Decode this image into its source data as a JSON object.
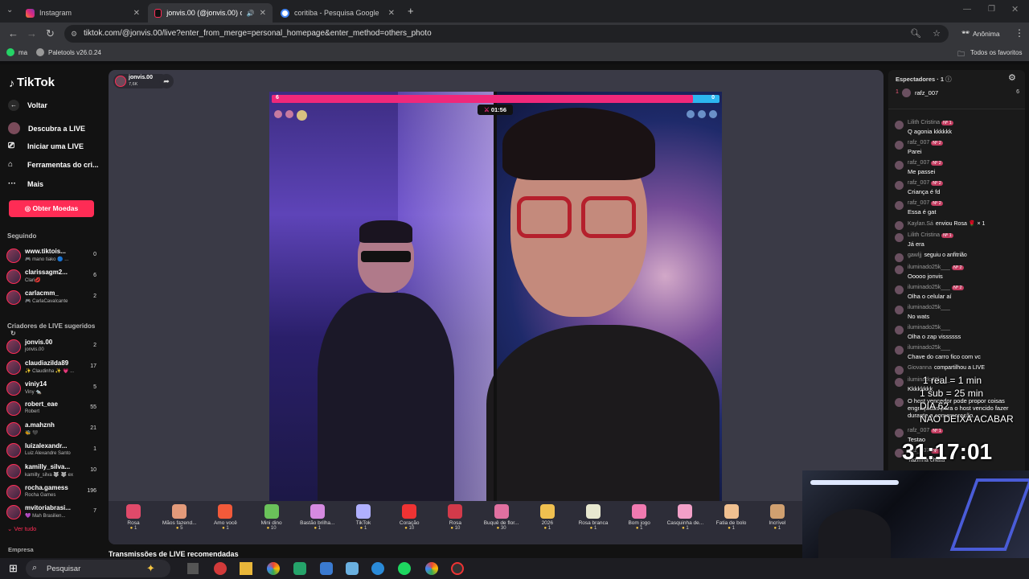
{
  "browser": {
    "tabs": [
      {
        "label": "Instagram",
        "color": "#e1306c"
      },
      {
        "label": "jonvis.00 (@jonvis.00) com...",
        "color": "#111111"
      },
      {
        "label": "coritiba - Pesquisa Google",
        "color": "#4285f4"
      }
    ],
    "url": "tiktok.com/@jonvis.00/live?enter_from_merge=personal_homepage&enter_method=others_photo",
    "profile_label": "Anônima",
    "bookmarks": [
      "ma",
      "Paletools v26.0.24"
    ],
    "favorites_label": "Todos os favoritos"
  },
  "sidebar": {
    "logo": "TikTok",
    "back_label": "Voltar",
    "nav": [
      {
        "label": "Descubra a LIVE",
        "icon": "live-avatar-icon"
      },
      {
        "label": "Iniciar uma LIVE",
        "icon": "camera-icon"
      },
      {
        "label": "Ferramentas do cri...",
        "icon": "home-icon"
      },
      {
        "label": "Mais",
        "icon": "more-icon"
      }
    ],
    "coins_button": "Obter Moedas",
    "following_title": "Seguindo",
    "following": [
      {
        "name": "www.tiktois...",
        "sub": "🎮 mano tiako 🔵 ...",
        "count": "0"
      },
      {
        "name": "clarissagm2...",
        "sub": "Clari💋",
        "count": "6"
      },
      {
        "name": "carlacmm_",
        "sub": "🎮 CarlaCavalcante",
        "count": "2"
      }
    ],
    "creators_title": "Criadores de LIVE sugeridos",
    "creators": [
      {
        "name": "jonvis.00",
        "sub": "jonvis.00",
        "count": "2"
      },
      {
        "name": "claudiazilda89",
        "sub": "✨ Claudinha ✨ 💗 ...",
        "count": "17"
      },
      {
        "name": "viniy14",
        "sub": "Viny 🐀",
        "count": "5"
      },
      {
        "name": "robert_eae",
        "sub": "Robert",
        "count": "55"
      },
      {
        "name": "a.mahznh",
        "sub": "🐝 🖤",
        "count": "21"
      },
      {
        "name": "luizalexandr...",
        "sub": "Luiz Alexandre Santo",
        "count": "1"
      },
      {
        "name": "kamilly_silva...",
        "sub": "kamilly_silva 🐺 🐺 ex",
        "count": "10"
      },
      {
        "name": "rocha.gamess",
        "sub": "Rocha Games",
        "count": "196"
      },
      {
        "name": "mvitoriabrasi...",
        "sub": "💜 Mah Brasilien...",
        "count": "7"
      }
    ],
    "see_all": "Ver tudo",
    "company": "Empresa"
  },
  "live": {
    "host": "jonvis.00",
    "likes": "7,6K",
    "score_left": "6",
    "score_right": "0",
    "timer": "01:56",
    "recommended_title": "Transmissões de LIVE recomendadas"
  },
  "gifts": [
    {
      "name": "Rosa",
      "price": "1",
      "color": "#e04a6a"
    },
    {
      "name": "Mãos fazend...",
      "price": "5",
      "color": "#e39a7a"
    },
    {
      "name": "Amo você",
      "price": "1",
      "color": "#f25a3a"
    },
    {
      "name": "Mini dino",
      "price": "10",
      "color": "#6ac25a"
    },
    {
      "name": "Bastão brilha...",
      "price": "1",
      "color": "#d58ae0"
    },
    {
      "name": "TikTok",
      "price": "1",
      "color": "#b0b0ff"
    },
    {
      "name": "Coração",
      "price": "10",
      "color": "#e33"
    },
    {
      "name": "Rosa",
      "price": "10",
      "color": "#d33a4a"
    },
    {
      "name": "Buquê de flor...",
      "price": "30",
      "color": "#e070a0"
    },
    {
      "name": "2026",
      "price": "1",
      "color": "#f0c050"
    },
    {
      "name": "Rosa branca",
      "price": "1",
      "color": "#e8e8d0"
    },
    {
      "name": "Bom jogo",
      "price": "1",
      "color": "#f07ab0"
    },
    {
      "name": "Casquinha de...",
      "price": "1",
      "color": "#f2a0c8"
    },
    {
      "name": "Fatia de bolo",
      "price": "1",
      "color": "#f0c090"
    },
    {
      "name": "Incrível",
      "price": "1",
      "color": "#d0a070"
    }
  ],
  "chat": {
    "viewers_title": "Espectadores",
    "viewers_count": "1",
    "top_viewer": {
      "rank": "1",
      "name": "rafz_007",
      "score": "6"
    },
    "messages": [
      {
        "user": "Lilith Cristina",
        "badge": "Nº 1",
        "text": "Q agonia kkkkkk"
      },
      {
        "user": "rafz_007",
        "badge": "Nº 2",
        "text": "Parei"
      },
      {
        "user": "rafz_007",
        "badge": "Nº 2",
        "text": "Me passei"
      },
      {
        "user": "rafz_007",
        "badge": "Nº 2",
        "text": "Criança é fd"
      },
      {
        "user": "rafz_007",
        "badge": "Nº 2",
        "text": "Essa é gat"
      },
      {
        "user": "Kaylan.Sá",
        "badge": "",
        "text": "enviou Rosa 🌹 × 1"
      },
      {
        "user": "Lilith Cristina",
        "badge": "Nº 1",
        "text": "Já era"
      },
      {
        "user": "gawljj",
        "badge": "",
        "text": "seguiu o anfitrião"
      },
      {
        "user": "iluminado25k___",
        "badge": "Nº 2",
        "text": "Ooooo jonvis"
      },
      {
        "user": "iluminado25k___",
        "badge": "Nº 2",
        "text": "Olha o celular aí"
      },
      {
        "user": "iluminado25k___",
        "badge": "",
        "text": "No wats"
      },
      {
        "user": "iluminado25k___",
        "badge": "",
        "text": "Olha o zap vissssss"
      },
      {
        "user": "iluminado25k___",
        "badge": "",
        "text": "Chave do carro fico com vc"
      },
      {
        "user": "Giovanna",
        "badge": "",
        "text": "compartilhou a LIVE"
      },
      {
        "user": "iluminado25k___",
        "badge": "",
        "text": "Kkkkkkkk"
      },
      {
        "user": "",
        "badge": "",
        "text": "O host vencedor pode propor coisas engraçadas para o host vencido fazer durante a comemoração."
      },
      {
        "user": "rafz_007",
        "badge": "Nº 1",
        "text": "Testao"
      },
      {
        "user": "rafz_007",
        "badge": "Nº 1",
        "text": "Tazinha chata"
      }
    ]
  },
  "overlay": {
    "line1": "1 real = 1 min",
    "line2": "1 sub = 25 min",
    "line3": "DIA 62",
    "line4": "NAO DEIXA ACABAR",
    "timer": "31:17:01"
  },
  "taskbar": {
    "search_placeholder": "Pesquisar"
  }
}
